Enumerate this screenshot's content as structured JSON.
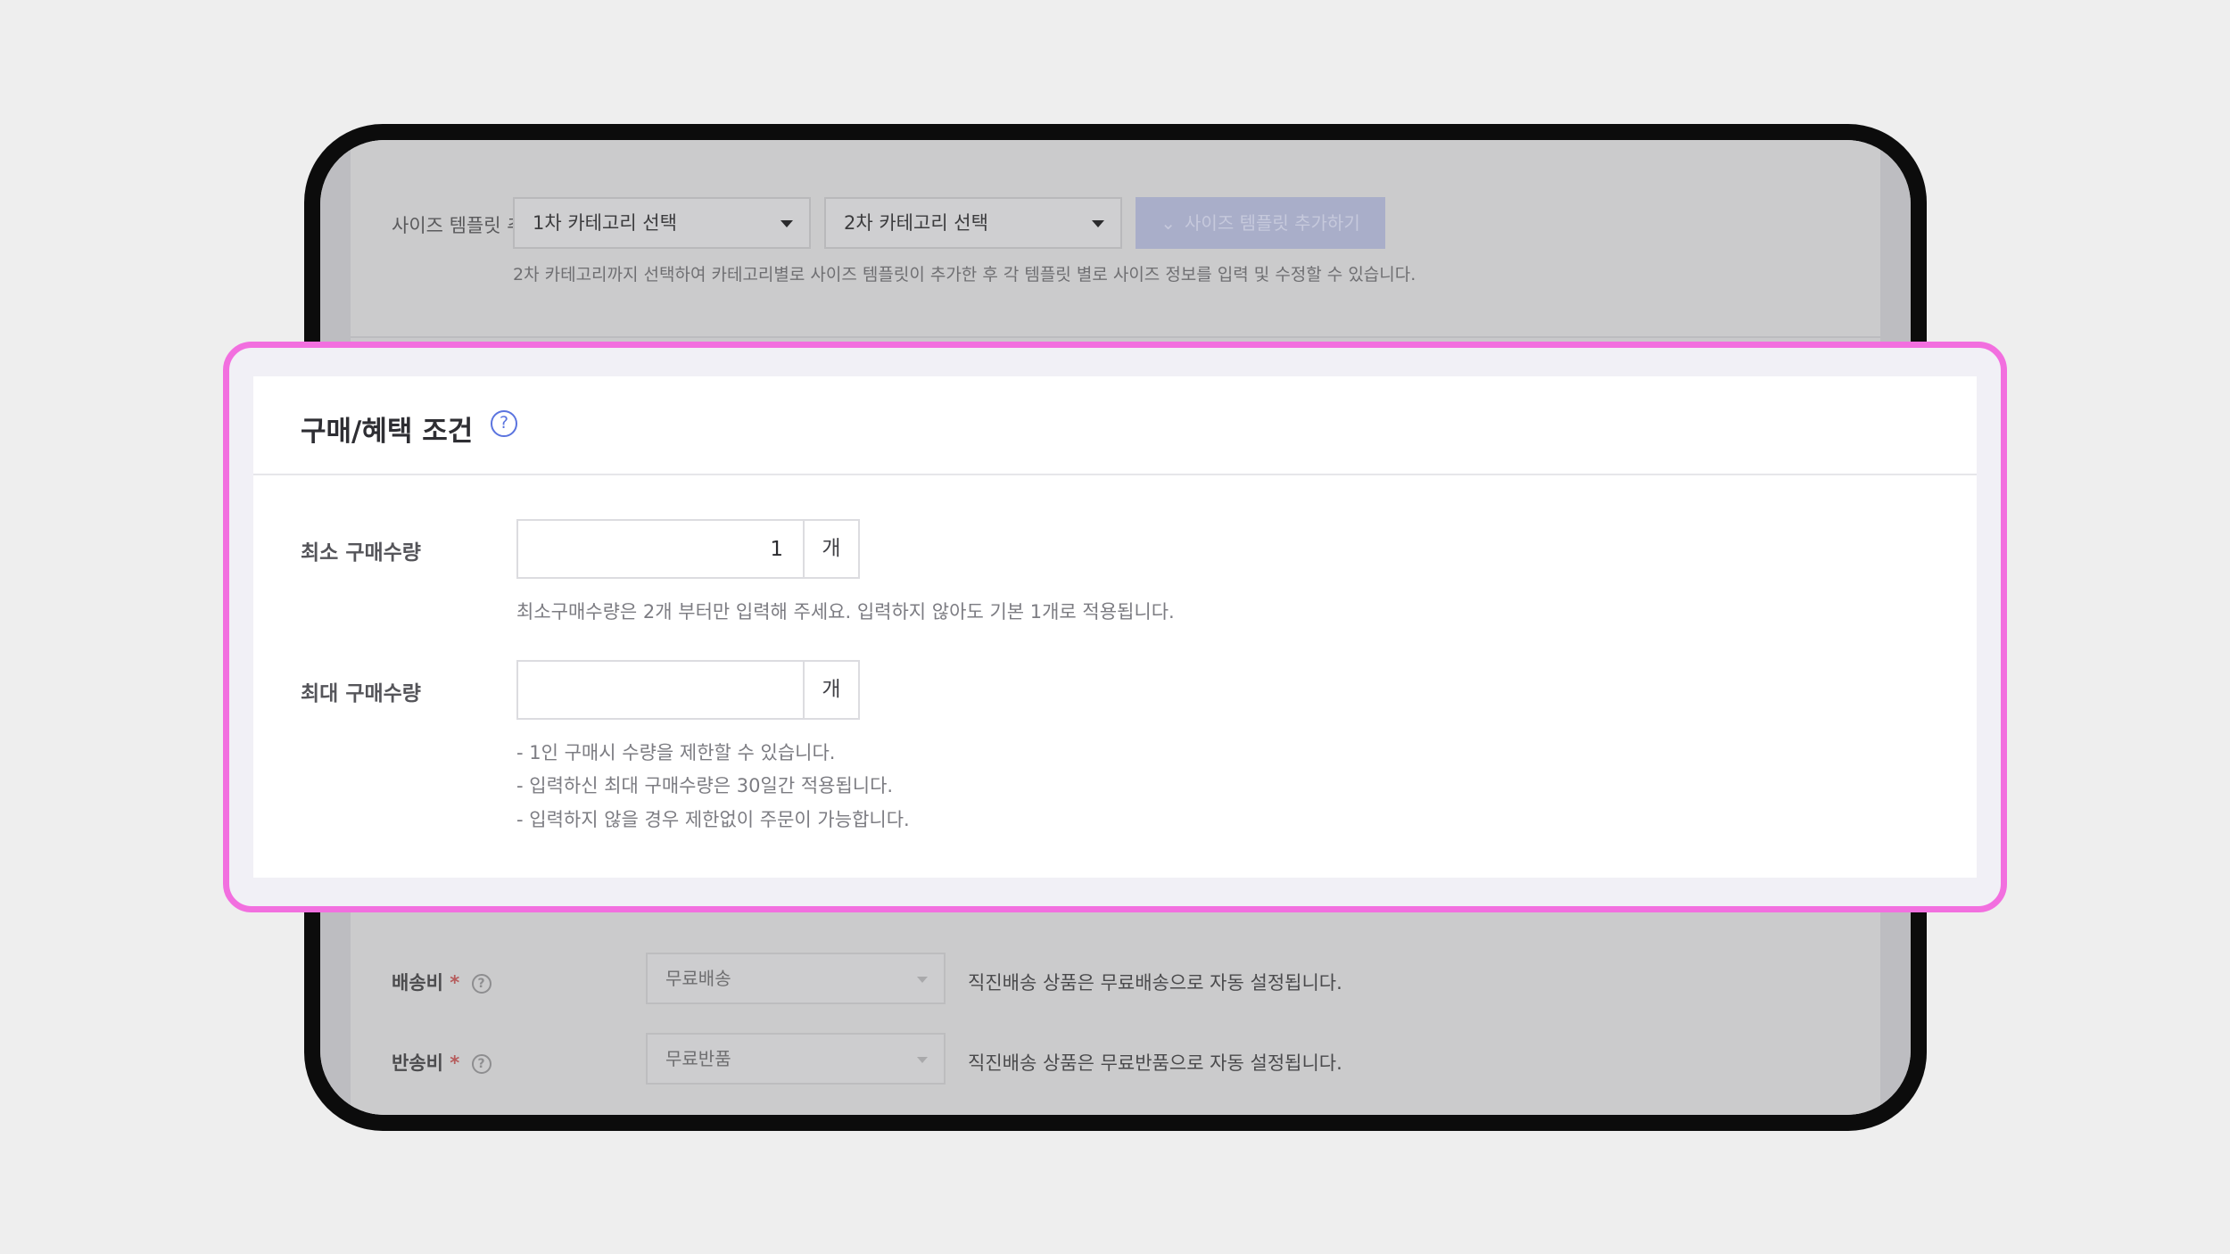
{
  "background_top": {
    "size_template_label": "사이즈 템플릿 추가",
    "category1_select": "1차 카테고리 선택",
    "category2_select": "2차 카테고리 선택",
    "add_template_button": "사이즈 템플릿 추가하기",
    "add_template_chevron": "⌄",
    "hint": "2차 카테고리까지 선택하여 카테고리별로 사이즈 템플릿이 추가한 후 각 템플릿 별로 사이즈 정보를 입력 및 수정할 수 있습니다."
  },
  "purchase_section": {
    "title": "구매/혜택 조건",
    "help_icon": "question-circle-icon",
    "help_glyph": "?",
    "min_label": "최소 구매수량",
    "min_value": "1",
    "min_unit": "개",
    "min_help": "최소구매수량은 2개 부터만 입력해 주세요. 입력하지 않아도 기본 1개로 적용됩니다.",
    "max_label": "최대 구매수량",
    "max_value": "",
    "max_unit": "개",
    "max_help": [
      "- 1인 구매시 수량을 제한할 수 있습니다.",
      "- 입력하신 최대 구매수량은 30일간 적용됩니다.",
      "- 입력하지 않을 경우 제한없이 주문이 가능합니다."
    ]
  },
  "background_bottom": {
    "shipping_label": "배송비",
    "shipping_select": "무료배송",
    "shipping_note": "직진배송 상품은 무료배송으로 자동 설정됩니다.",
    "return_label": "반송비",
    "return_select": "무료반품",
    "return_note": "직진배송 상품은 무료반품으로 자동 설정됩니다.",
    "required_mark": "*",
    "help_glyph": "?"
  },
  "colors": {
    "highlight_border": "#f26fdf",
    "help_icon": "#5b74df",
    "page_background": "#eeeeee"
  }
}
